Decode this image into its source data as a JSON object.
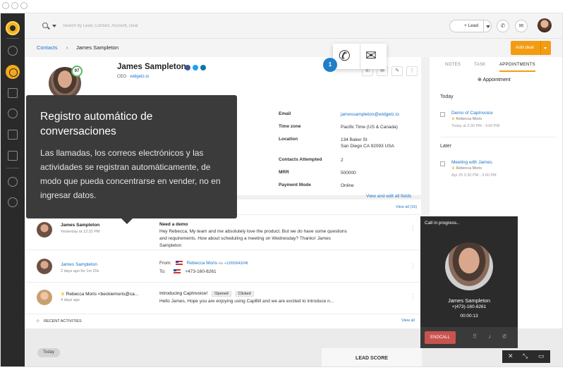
{
  "topbar": {
    "search_placeholder": "Search by Lead, Contact, Account, Deal",
    "lead_button": "+ Lead"
  },
  "breadcrumb": {
    "parent": "Contacts",
    "separator": "›",
    "current": "James Sampleton",
    "add_deal": "Add deal"
  },
  "profile": {
    "name": "James Sampleton",
    "role": "CEO",
    "company": "widgetz.io",
    "score": "97"
  },
  "fields": [
    {
      "label": "Email",
      "value": "jamessampleton@widgetz.io"
    },
    {
      "label": "Time zone",
      "value": "Pacific Time (US & Canada)"
    },
    {
      "label": "Location",
      "value": "134 Baker St\nSan Diego CA 92093 USA"
    },
    {
      "label": "Contacts Attempted",
      "value": "2"
    },
    {
      "label": "MRR",
      "value": "500000"
    },
    {
      "label": "Payment Mode",
      "value": "Online"
    }
  ],
  "view_edit": "View and edit all fields",
  "conversations_view_all": "View all (15)",
  "rows": [
    {
      "name": "James Sampleton",
      "meta": "Yesterday at 12:32 PM",
      "subject": "Need a demo",
      "body": "Hey Rebecca, My team and me absolutely love the product.  But we do have some questions and requirements. How about scheduling a meeting on Wednesday? Thanks! James Sampleton"
    },
    {
      "name": "James Sampleton",
      "meta": "2 days ago for 1m 20s",
      "from_label": "From:",
      "from_name": "Rebecca Moris",
      "from_via": "via",
      "from_number": "+12093643248",
      "to_label": "To:",
      "to_number": "+473-160-8261"
    },
    {
      "name": "Rebecca Moris <beckiemoris@ca...",
      "meta": "4 days ago",
      "subject": "Introducing CapInvoice!",
      "tag1": "Opened",
      "tag2": "Clicked",
      "body": "Hello James, Hope you are enjoying using CapBill and we are excited to introduce n..."
    }
  ],
  "recent": {
    "label": "RECENT ACTIVITIES",
    "view_all": "View all"
  },
  "timeline": {
    "today": "Today",
    "lead_score": "LEAD SCORE"
  },
  "right_panel": {
    "tabs": [
      "NOTES",
      "TASK",
      "APPOINTMENTS"
    ],
    "add_appointment": "Appointment",
    "today": "Today",
    "item1": {
      "title": "Demo of CapInvoice",
      "owner": "Rebecca Moris",
      "time": "Today at 2:30 PM - 3:00 PM"
    },
    "later": "Later",
    "item2": {
      "title": "Meeting with James.",
      "owner": "Rebecca Moris",
      "time": "Apr 25 2:30 PM - 3:00 PM"
    }
  },
  "tour": {
    "step": "1",
    "title": "Registro automático de conversaciones",
    "body": "Las llamadas, los correos electrónicos y las actividades se registran automáticamente, de modo que pueda concentrarse en vender, no en ingresar datos."
  },
  "call": {
    "status": "Call in progress..",
    "name": "James Sampleton",
    "number": "+(473)-160-8261",
    "timer": "00:00:13",
    "end": "ENDCALL"
  },
  "colors": {
    "accent": "#f39c12",
    "link": "#1a73c9",
    "sidebar": "#2a2a2a",
    "tour_badge": "#1f7fc7",
    "end_call": "#c9534f"
  }
}
